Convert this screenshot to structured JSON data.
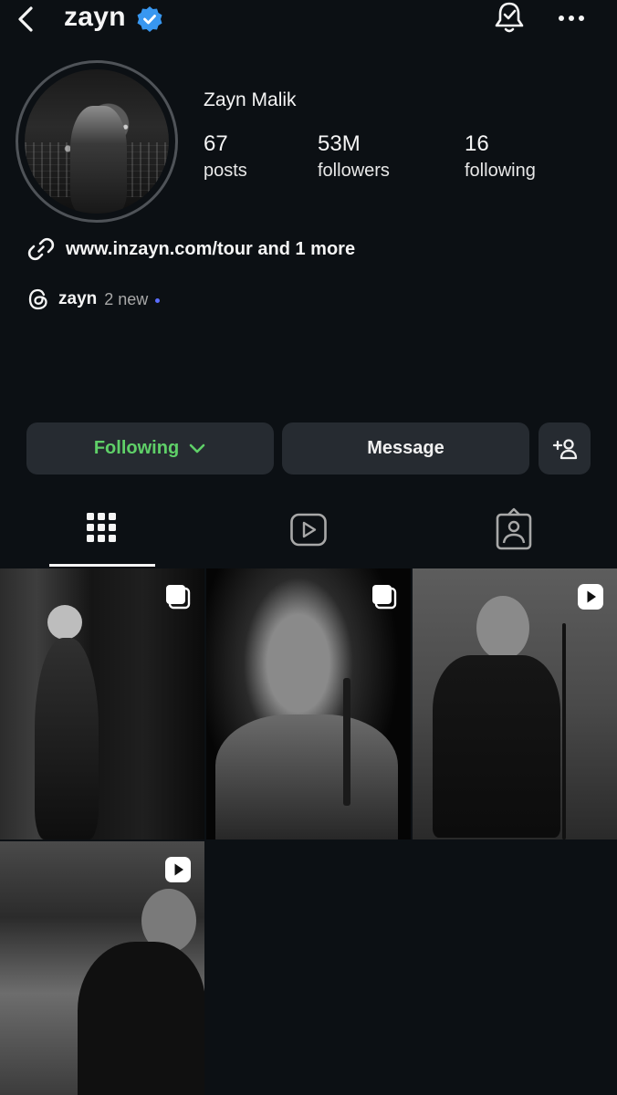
{
  "header": {
    "username": "zayn",
    "verified": true
  },
  "profile": {
    "full_name": "Zayn Malik",
    "stats": [
      {
        "value": "67",
        "label": "posts"
      },
      {
        "value": "53M",
        "label": "followers"
      },
      {
        "value": "16",
        "label": "following"
      }
    ],
    "link_text": "www.inzayn.com/tour and 1 more",
    "threads": {
      "name": "zayn",
      "badge_text": "2 new"
    }
  },
  "actions": {
    "following_label": "Following",
    "message_label": "Message"
  },
  "tabs": [
    {
      "name": "posts-grid",
      "icon": "grid-icon",
      "active": true
    },
    {
      "name": "reels",
      "icon": "reels-icon",
      "active": false
    },
    {
      "name": "tagged",
      "icon": "tagged-icon",
      "active": false
    }
  ],
  "colors": {
    "background": "#0c1014",
    "button_bg": "#262b31",
    "following_green": "#5fd068",
    "verified_blue": "#3897f0",
    "threads_dot": "#5b6dff"
  },
  "grid_posts": [
    {
      "type": "carousel",
      "badge_icon": "carousel-icon"
    },
    {
      "type": "carousel",
      "badge_icon": "carousel-icon"
    },
    {
      "type": "reel",
      "badge_icon": "reel-play-icon"
    },
    {
      "type": "reel",
      "badge_icon": "reel-play-icon"
    }
  ]
}
